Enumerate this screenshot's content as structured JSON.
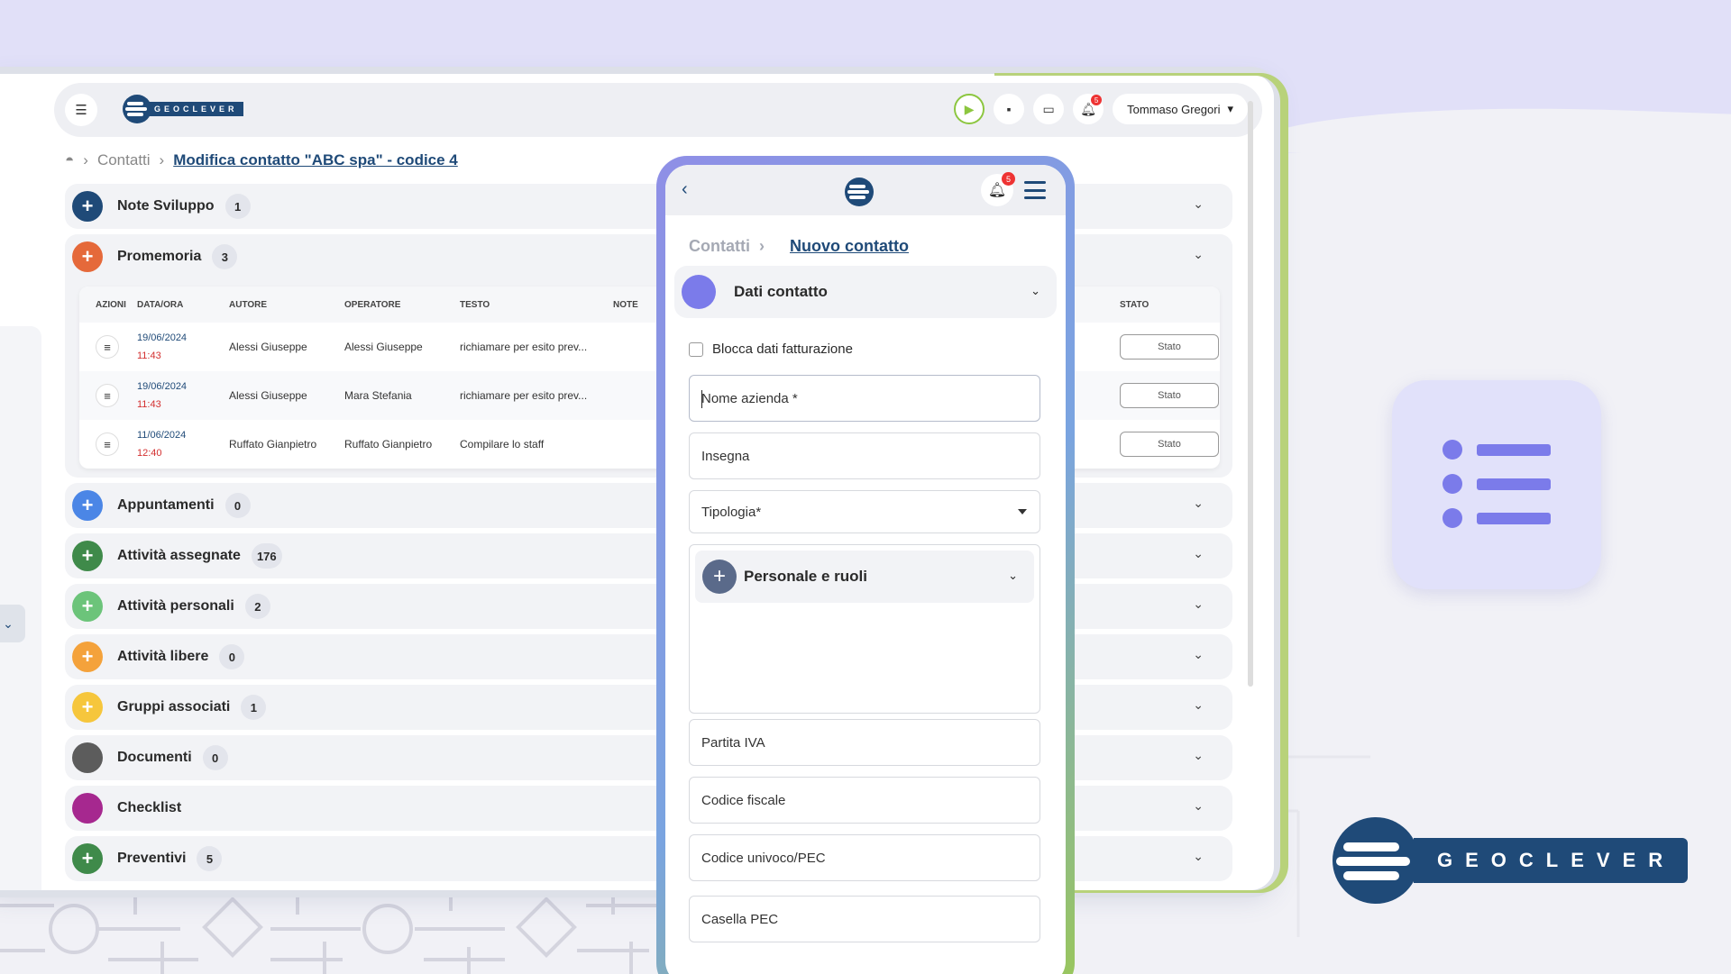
{
  "brand": {
    "name": "GEOCLEVER"
  },
  "topbar": {
    "user_name": "Tommaso Gregori",
    "notif_count": "5"
  },
  "breadcrumb": {
    "parent": "Contatti",
    "current": "Modifica contatto \"ABC spa\" - codice 4"
  },
  "sections": [
    {
      "title": "Note Sviluppo",
      "count": "1",
      "color": "#1f4a78"
    },
    {
      "title": "Promemoria",
      "count": "3",
      "color": "#e5693a"
    },
    {
      "title": "Appuntamenti",
      "count": "0",
      "color": "#4b86e6"
    },
    {
      "title": "Attività assegnate",
      "count": "176",
      "color": "#3f8a4a"
    },
    {
      "title": "Attività personali",
      "count": "2",
      "color": "#6cc47a"
    },
    {
      "title": "Attività libere",
      "count": "0",
      "color": "#f4a23b"
    },
    {
      "title": "Gruppi associati",
      "count": "1",
      "color": "#f6c63c"
    },
    {
      "title": "Documenti",
      "count": "0",
      "color": "#5c5c5c"
    },
    {
      "title": "Checklist",
      "count": "",
      "color": "#a6288f"
    },
    {
      "title": "Preventivi",
      "count": "5",
      "color": "#3f8a4a"
    }
  ],
  "table": {
    "headers": [
      "AZIONI",
      "DATA/ORA",
      "AUTORE",
      "OPERATORE",
      "TESTO",
      "NOTE",
      "STATO"
    ],
    "rows": [
      {
        "date": "19/06/2024",
        "time": "11:43",
        "author": "Alessi Giuseppe",
        "operator": "Alessi Giuseppe",
        "text": "richiamare per esito prev...",
        "state": "Stato"
      },
      {
        "date": "19/06/2024",
        "time": "11:43",
        "author": "Alessi Giuseppe",
        "operator": "Mara Stefania",
        "text": "richiamare per esito prev...",
        "state": "Stato"
      },
      {
        "date": "11/06/2024",
        "time": "12:40",
        "author": "Ruffato Gianpietro",
        "operator": "Ruffato Gianpietro",
        "text": "Compilare lo staff",
        "state": "Stato"
      }
    ]
  },
  "mobile": {
    "notif_count": "5",
    "breadcrumb_parent": "Contatti",
    "breadcrumb_current": "Nuovo contatto",
    "section_title": "Dati contatto",
    "checkbox_label": "Blocca dati fatturazione",
    "fields": {
      "nome": "Nome azienda *",
      "insegna": "Insegna",
      "tipologia": "Tipologia*",
      "partita_iva": "Partita IVA",
      "codice_fiscale": "Codice fiscale",
      "codice_univoco": "Codice univoco/PEC",
      "casella_pec": "Casella PEC"
    },
    "subsection_title": "Personale e ruoli"
  },
  "colors": {
    "brand_blue": "#1f4a78",
    "accent_purple": "#7b7bea",
    "accent_green": "#8cc63f"
  }
}
